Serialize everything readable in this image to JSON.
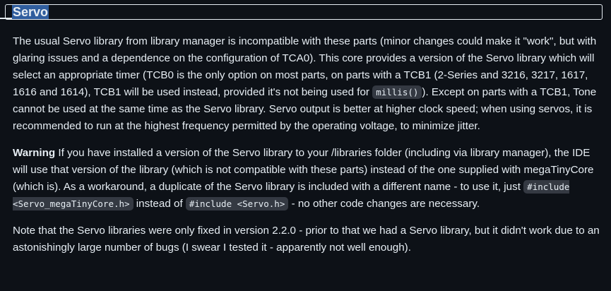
{
  "section": {
    "heading": "Servo"
  },
  "paragraphs": {
    "p1": {
      "text_a": "The usual Servo library from library manager is incompatible with these parts (minor changes could make it \"work\", but with glaring issues and a dependence on the configuration of TCA0). This core provides a version of the Servo library which will select an appropriate timer (TCB0 is the only option on most parts, on parts with a TCB1 (2-Series and 3216, 3217, 1617, 1616 and 1614), TCB1 will be used instead, provided it's not being used for ",
      "code_a": "millis()",
      "text_b": "). Except on parts with a TCB1, Tone cannot be used at the same time as the Servo library. Servo output is better at higher clock speed; when using servos, it is recommended to run at the highest frequency permitted by the operating voltage, to minimize jitter."
    },
    "p2": {
      "label": "Warning",
      "text_a": " If you have installed a version of the Servo library to your /libraries folder (including via library manager), the IDE will use that version of the library (which is not compatible with these parts) instead of the one supplied with megaTinyCore (which is). As a workaround, a duplicate of the Servo library is included with a different name - to use it, just ",
      "code_a": "#include <Servo_megaTinyCore.h>",
      "text_b": " instead of ",
      "code_b": "#include <Servo.h>",
      "text_c": " - no other code changes are necessary."
    },
    "p3": {
      "text": "Note that the Servo libraries were only fixed in version 2.2.0 - prior to that we had a Servo library, but it didn't work due to an astonishingly large number of bugs (I swear I tested it - apparently not well enough)."
    }
  }
}
